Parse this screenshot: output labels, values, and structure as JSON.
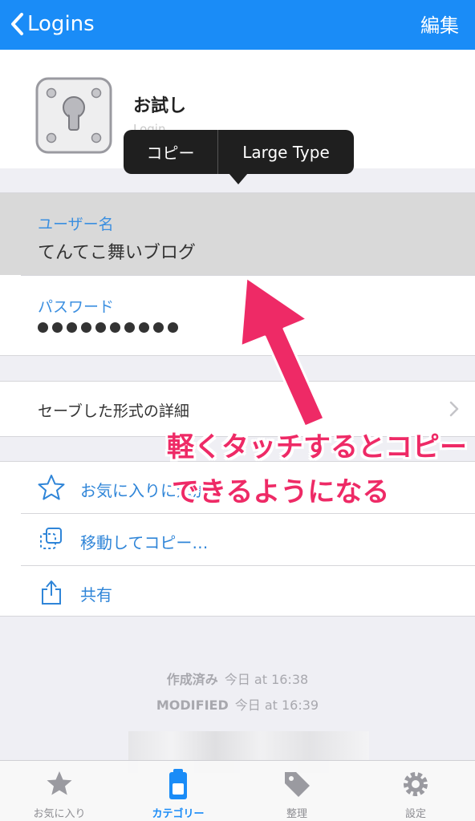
{
  "navbar": {
    "back_label": "Logins",
    "edit_label": "編集"
  },
  "item": {
    "title": "お試し",
    "subtitle": "Login"
  },
  "popup": {
    "copy_label": "コピー",
    "large_type_label": "Large Type"
  },
  "fields": {
    "username": {
      "label": "ユーザー名",
      "value": "てんてこ舞いブログ"
    },
    "password": {
      "label": "パスワード",
      "masked_length": 10
    }
  },
  "details": {
    "label": "セーブした形式の詳細"
  },
  "actions": [
    {
      "label": "お気に入りに追加",
      "icon": "star-icon"
    },
    {
      "label": "移動してコピー…",
      "icon": "move-copy-icon"
    },
    {
      "label": "共有",
      "icon": "share-icon"
    }
  ],
  "meta": {
    "created_label": "作成済み",
    "created_value": "今日 at 16:38",
    "modified_label": "MODIFIED",
    "modified_value": "今日 at 16:39"
  },
  "tabbar": [
    {
      "label": "お気に入り",
      "icon": "star-icon"
    },
    {
      "label": "カテゴリー",
      "icon": "category-icon",
      "active": true
    },
    {
      "label": "整理",
      "icon": "tag-icon"
    },
    {
      "label": "設定",
      "icon": "gear-icon"
    }
  ],
  "annotation": {
    "line1": "軽くタッチするとコピー",
    "line2": "できるようになる"
  },
  "colors": {
    "accent": "#1a8cf7",
    "annotation": "#ee2a66",
    "link": "#2f85d8"
  }
}
